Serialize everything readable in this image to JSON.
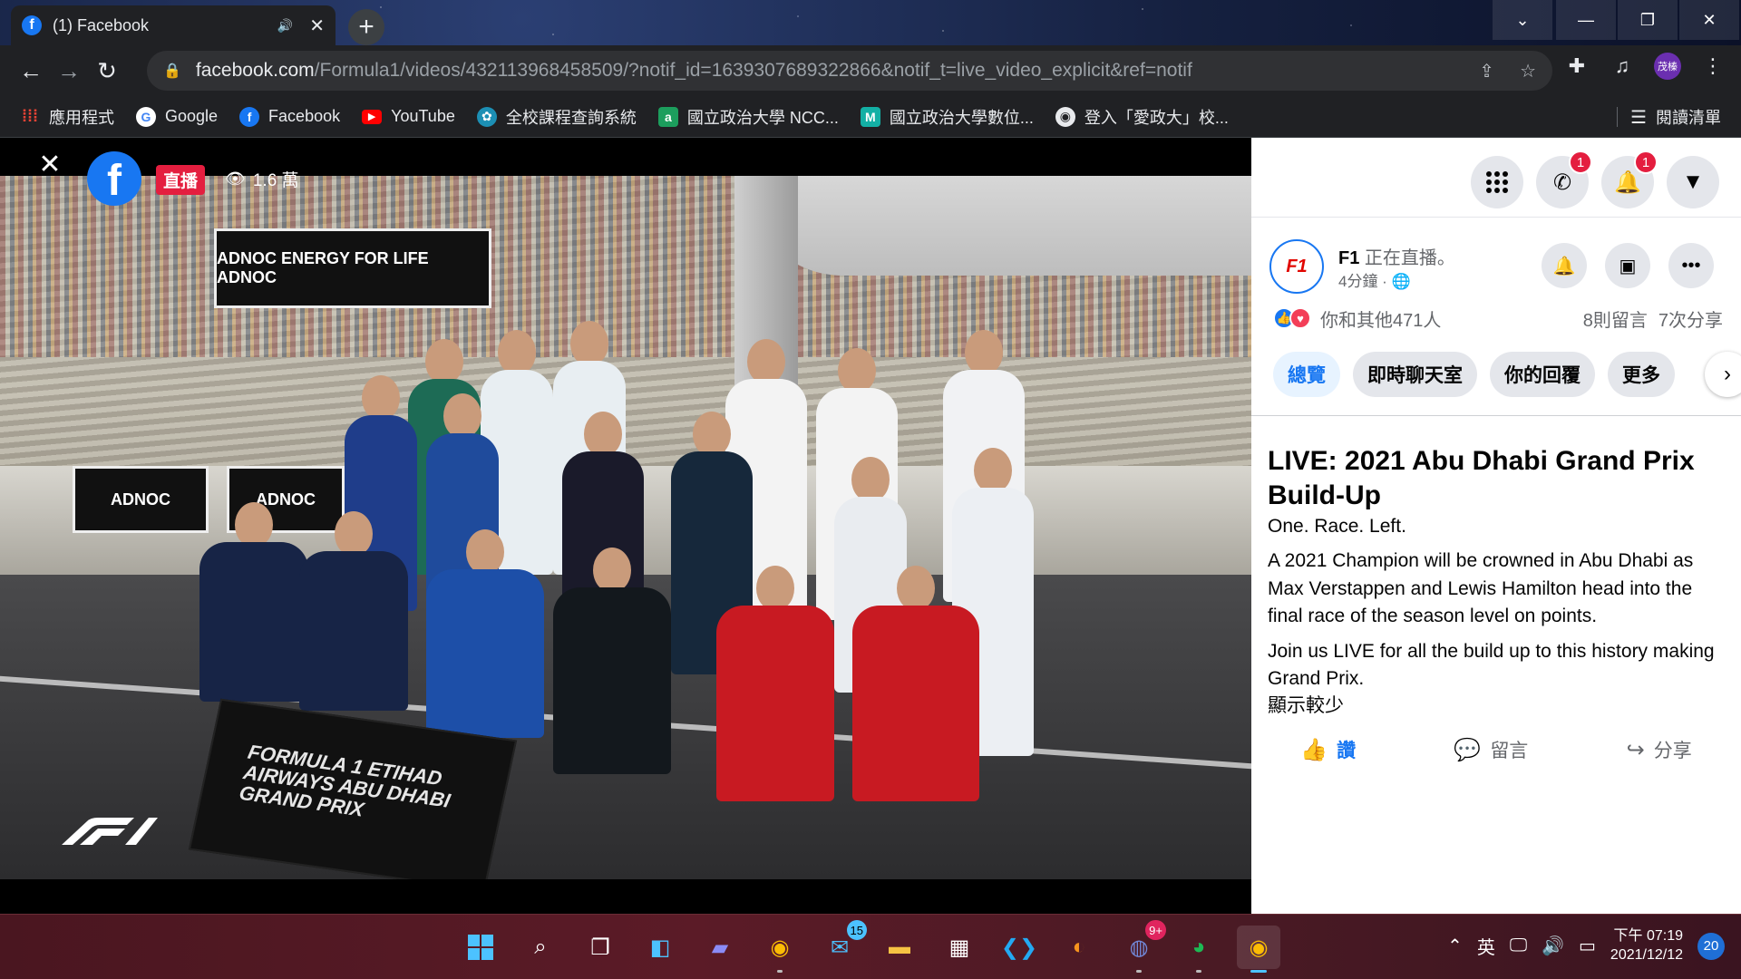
{
  "browser": {
    "tab_title": "(1) Facebook",
    "tab_favicon": "f",
    "new_tab": "+",
    "url_host": "facebook.com",
    "url_path": "/Formula1/videos/432113968458509/?notif_id=1639307689322866&notif_t=live_video_explicit&ref=notif",
    "profile_initials": "茂榛"
  },
  "bookmarks": [
    {
      "label": "應用程式",
      "icon": "apps-grid-icon",
      "color": "#ea4335",
      "glyph": "⋮⋮"
    },
    {
      "label": "Google",
      "icon": "google-icon",
      "color": "#ffffff",
      "glyph": "G"
    },
    {
      "label": "Facebook",
      "icon": "facebook-icon",
      "color": "#1877f2",
      "glyph": "f"
    },
    {
      "label": "YouTube",
      "icon": "youtube-icon",
      "color": "#ff0000",
      "glyph": "▶"
    },
    {
      "label": "全校課程查詢系統",
      "icon": "course-icon",
      "color": "#1c8fb4",
      "glyph": "✿"
    },
    {
      "label": "國立政治大學 NCC...",
      "icon": "nccu-icon",
      "color": "#1c9e5d",
      "glyph": "a"
    },
    {
      "label": "國立政治大學數位...",
      "icon": "moodle-icon",
      "color": "#13b0a5",
      "glyph": "M"
    },
    {
      "label": "登入「愛政大」校...",
      "icon": "globe-icon",
      "color": "#5f6368",
      "glyph": "◉"
    }
  ],
  "reading_list": "閱讀清單",
  "video": {
    "live_label": "直播",
    "views": "1.6 萬",
    "banner_text": "ADNOC  ENERGY FOR LIFE  ADNOC",
    "wall_text": "ADNOC",
    "board_text": "FORMULA 1 ETIHAD AIRWAYS ABU DHABI GRAND PRIX"
  },
  "fb_header": {
    "messenger_badge": "1",
    "notifications_badge": "1"
  },
  "post": {
    "page_name": "F1",
    "status": "正在直播。",
    "time": "4分鐘 · 🌐",
    "reactions_text": "你和其他471人",
    "comments": "8則留言",
    "shares": "7次分享",
    "tabs": [
      "總覽",
      "即時聊天室",
      "你的回覆",
      "更多"
    ],
    "title": "LIVE: 2021 Abu Dhabi Grand Prix Build-Up",
    "paragraphs": [
      "One. Race. Left.",
      "A 2021 Champion will be crowned in Abu Dhabi as Max Verstappen and Lewis Hamilton head into the final race of the season level on points.",
      "Join us LIVE for all the build up to this history making Grand Prix."
    ],
    "show_less": "顯示較少",
    "actions": {
      "like": "讚",
      "comment": "留言",
      "share": "分享"
    }
  },
  "taskbar": {
    "mail_badge": "15",
    "discord_badge": "9+",
    "ime": "英",
    "time": "下午 07:19",
    "date": "2021/12/12",
    "notification_count": "20"
  },
  "colors": {
    "fb_blue": "#1877f2",
    "live_red": "#e41e3f",
    "chrome_dark": "#202124"
  }
}
